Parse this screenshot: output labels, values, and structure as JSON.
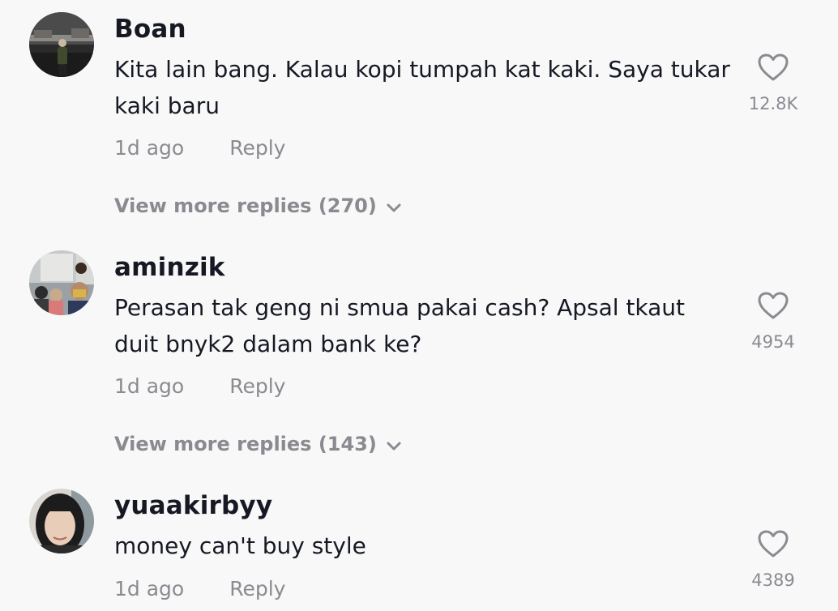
{
  "comments": [
    {
      "username": "Boan",
      "text": "Kita lain bang. Kalau kopi tumpah kat kaki. Saya tukar kaki baru",
      "time": "1d ago",
      "reply_label": "Reply",
      "likes": "12.8K",
      "view_more": "View more replies (270)"
    },
    {
      "username": "aminzik",
      "text": "Perasan tak geng ni smua pakai cash? Apsal tkaut duit bnyk2 dalam bank ke?",
      "time": "1d ago",
      "reply_label": "Reply",
      "likes": "4954",
      "view_more": "View more replies (143)"
    },
    {
      "username": "yuaakirbyy",
      "text": "money can't buy style",
      "time": "1d ago",
      "reply_label": "Reply",
      "likes": "4389"
    }
  ],
  "icons": {
    "like": "heart-outline-icon",
    "expand": "chevron-down-icon"
  },
  "colors": {
    "background": "#f8f8f8",
    "primary_text": "#161823",
    "secondary_text": "#8a8b91"
  }
}
